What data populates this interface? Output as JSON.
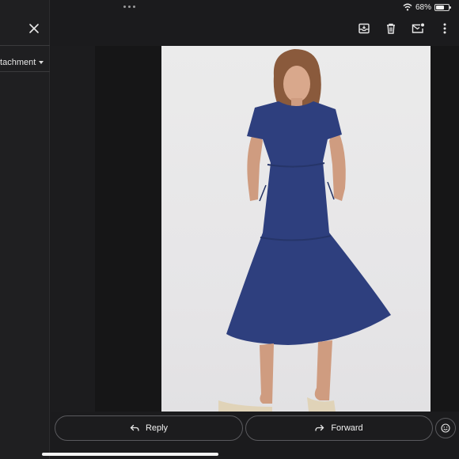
{
  "status_bar": {
    "battery_percent": "68%",
    "battery_level": 0.68
  },
  "left_pane": {
    "attachment_label": "ttachment"
  },
  "toolbar": {
    "icons": [
      "archive-icon",
      "trash-icon",
      "mark-unread-icon",
      "more-vertical-icon"
    ]
  },
  "actions": {
    "reply_label": "Reply",
    "forward_label": "Forward"
  },
  "colors": {
    "background": "#1b1b1d",
    "dress": "#2e3f7e",
    "photo_background": "#e9e8ea"
  }
}
